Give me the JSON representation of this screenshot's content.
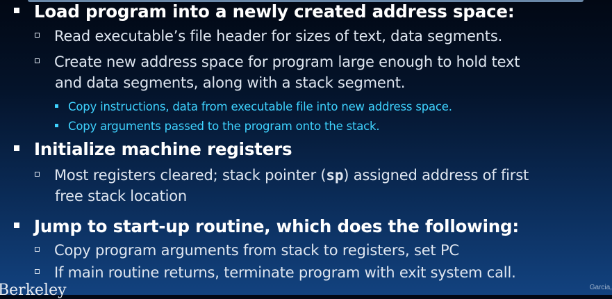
{
  "items": [
    {
      "level": 1,
      "text": "Load program into a newly created address space:"
    },
    {
      "level": 2,
      "text": "Read executable’s file header for sizes of text, data segments."
    },
    {
      "level": 2,
      "text": "Create new address space for program large enough to hold text"
    },
    {
      "level": 2,
      "text": "and data segments, along with a stack segment."
    },
    {
      "level": 3,
      "text": "Copy instructions, data from executable file into new address space."
    },
    {
      "level": 3,
      "text": "Copy arguments passed to the program onto the stack."
    },
    {
      "level": 1,
      "text": "Initialize machine registers"
    },
    {
      "level": 2,
      "text_before": "Most registers cleared; stack pointer (",
      "code": "sp",
      "text_after": ") assigned address of first"
    },
    {
      "level": 2,
      "text": "free stack location"
    },
    {
      "level": 1,
      "text": "Jump to start-up routine, which does the following:"
    },
    {
      "level": 2,
      "text": "Copy program arguments from stack to registers, set PC"
    },
    {
      "level": 2,
      "text": "If main routine returns, terminate program with exit system call."
    }
  ],
  "footer": {
    "left": "Berkeley",
    "right": "Garcia,"
  }
}
